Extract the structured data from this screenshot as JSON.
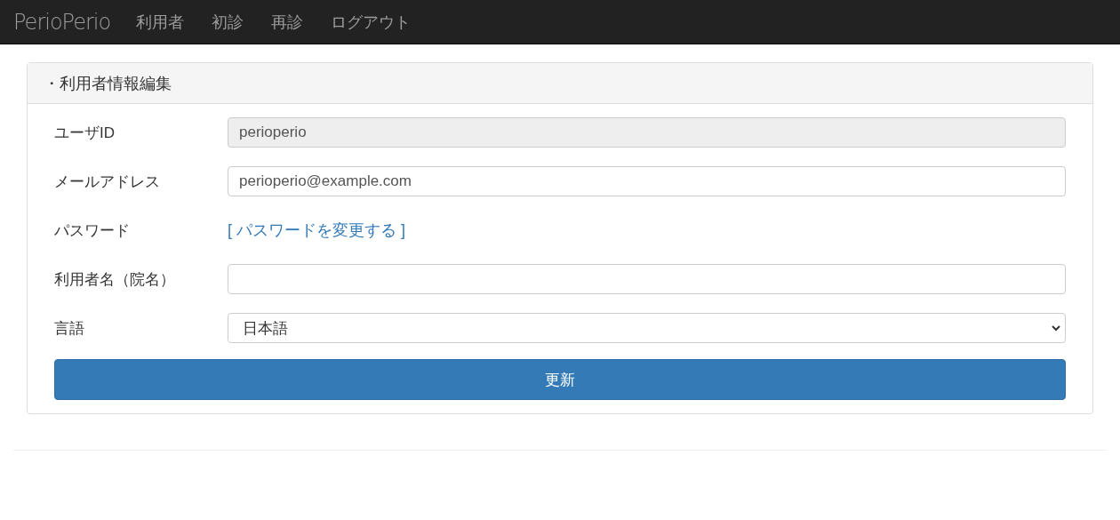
{
  "navbar": {
    "brand": "PerioPerio",
    "links": [
      "利用者",
      "初診",
      "再診",
      "ログアウト"
    ]
  },
  "panel": {
    "title": "・利用者情報編集",
    "rows": [
      {
        "kind": "input",
        "label": "ユーザID",
        "value": "perioperio",
        "disabled": true
      },
      {
        "kind": "input",
        "label": "メールアドレス",
        "value": "perioperio@example.com",
        "disabled": false
      },
      {
        "kind": "link",
        "label": "パスワード",
        "link": "[ パスワードを変更する ]"
      },
      {
        "kind": "input",
        "label": "利用者名（院名）",
        "value": "",
        "disabled": false
      },
      {
        "kind": "select",
        "label": "言語",
        "value": "日本語"
      }
    ],
    "button": "更新"
  }
}
